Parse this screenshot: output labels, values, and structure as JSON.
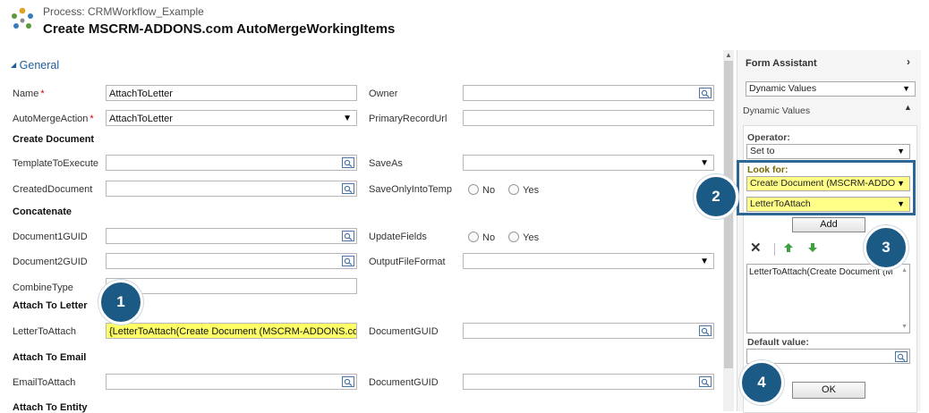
{
  "header": {
    "process_label": "Process: CRMWorkflow_Example",
    "title": "Create MSCRM-ADDONS.com AutoMergeWorkingItems",
    "logo_icon": "workflow-gears-icon"
  },
  "section": {
    "general_label": "General"
  },
  "fields": {
    "name": {
      "label": "Name",
      "value": "AttachToLetter"
    },
    "owner": {
      "label": "Owner",
      "value": ""
    },
    "automerge_action": {
      "label": "AutoMergeAction",
      "value": "AttachToLetter"
    },
    "primary_record_url": {
      "label": "PrimaryRecordUrl",
      "value": ""
    },
    "create_document_heading": "Create Document",
    "template_to_execute": {
      "label": "TemplateToExecute",
      "value": ""
    },
    "save_as": {
      "label": "SaveAs",
      "value": ""
    },
    "created_document": {
      "label": "CreatedDocument",
      "value": ""
    },
    "save_only_into_temp": {
      "label": "SaveOnlyIntoTemp",
      "no": "No",
      "yes": "Yes"
    },
    "concatenate_heading": "Concatenate",
    "document1_guid": {
      "label": "Document1GUID",
      "value": ""
    },
    "update_fields": {
      "label": "UpdateFields",
      "no": "No",
      "yes": "Yes"
    },
    "document2_guid": {
      "label": "Document2GUID",
      "value": ""
    },
    "output_file_format": {
      "label": "OutputFileFormat",
      "value": ""
    },
    "combine_type": {
      "label": "CombineType",
      "value": ""
    },
    "attach_to_letter_heading": "Attach To Letter",
    "letter_to_attach": {
      "label": "LetterToAttach",
      "value": "{LetterToAttach(Create Document (MSCRM-ADDONS.com"
    },
    "document_guid_1": {
      "label": "DocumentGUID",
      "value": ""
    },
    "attach_to_email_heading": "Attach To Email",
    "email_to_attach": {
      "label": "EmailToAttach",
      "value": ""
    },
    "document_guid_2": {
      "label": "DocumentGUID",
      "value": ""
    },
    "attach_to_entity_heading": "Attach To Entity"
  },
  "form_assistant": {
    "title": "Form Assistant",
    "expand_icon": "chevron-right-icon",
    "dropdown_value": "Dynamic Values",
    "section_label": "Dynamic Values",
    "operator_label": "Operator:",
    "operator_value": "Set to",
    "look_for_label": "Look for:",
    "look_for_entity": "Create Document (MSCRM-ADDO",
    "look_for_field": "LetterToAttach",
    "add_button": "Add",
    "list_items": [
      "LetterToAttach(Create Document (M"
    ],
    "default_value_label": "Default value:",
    "ok_button": "OK"
  },
  "badges": [
    "1",
    "2",
    "3",
    "4"
  ],
  "colors": {
    "badge": "#1c5a86",
    "highlight": "#ffff66",
    "accent_link": "#1f5c99"
  }
}
